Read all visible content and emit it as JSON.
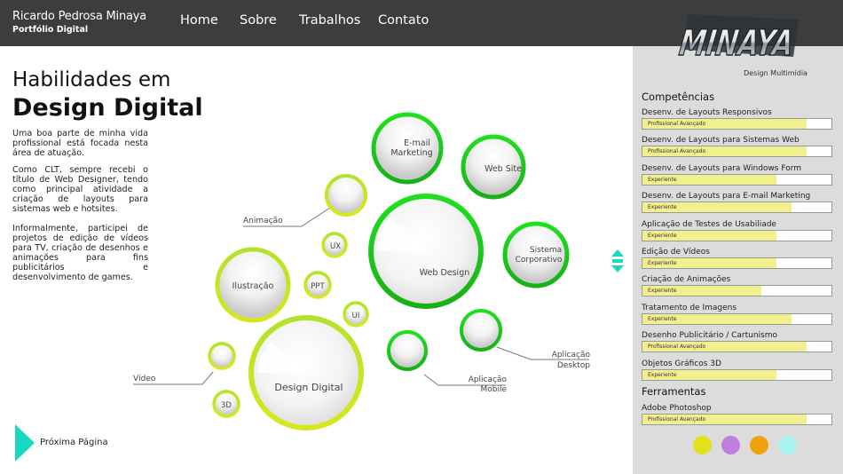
{
  "header": {
    "brand_name": "Ricardo Pedrosa Minaya",
    "brand_sub": "Portfólio Digital",
    "nav": [
      "Home",
      "Sobre",
      "Trabalhos",
      "Contato"
    ]
  },
  "logo": {
    "text": "MINAYA",
    "tagline": "Design Multimídia"
  },
  "intro": {
    "title_line1": "Habilidades em",
    "title_line2": "Design Digital",
    "paragraphs": [
      "Uma boa parte de minha vida profissional está focada nesta área de atuação.",
      "Como CLT, sempre recebi o título de Web Designer, tendo como principal atividade a criação de layouts para sistemas web e hotsites.",
      "Informalmente, participei de projetos de edição de vídeos para TV, criação de desenhos e animações para fins publicitários e desenvolvimento de games."
    ]
  },
  "bubbles": {
    "email": "E-mail\nMarketing",
    "website": "Web Site",
    "sistema": "Sistema\nCorporativo",
    "webdesign": "Web Design",
    "ilustracao": "Ilustração",
    "designdigital": "Design Digital",
    "ux": "UX",
    "ppt": "PPT",
    "ui": "UI",
    "threed": "3D",
    "animacao": "Animação",
    "video": "Vídeo",
    "app_mobile": "Aplicação\nMobile",
    "app_desktop": "Aplicação\nDesktop"
  },
  "competencias": {
    "title": "Competências",
    "items": [
      {
        "label": "Desenv. de Layouts Responsivos",
        "level": "Profissional Avançado",
        "pct": 0.87
      },
      {
        "label": "Desenv. de Layouts para Sistemas Web",
        "level": "Profissional Avançado",
        "pct": 0.87
      },
      {
        "label": "Desenv. de Layouts para Windows Form",
        "level": "Experiente",
        "pct": 0.71
      },
      {
        "label": "Desenv. de Layouts para E-mail Marketing",
        "level": "Experiente",
        "pct": 0.79
      },
      {
        "label": "Aplicação de Testes de Usabiliade",
        "level": "Experiente",
        "pct": 0.71
      },
      {
        "label": "Edição de Vídeos",
        "level": "Experiente",
        "pct": 0.71
      },
      {
        "label": "Criação de Animações",
        "level": "Experiente",
        "pct": 0.63
      },
      {
        "label": "Tratamento de Imagens",
        "level": "Experiente",
        "pct": 0.79
      },
      {
        "label": "Desenho Publicitário / Cartunismo",
        "level": "Profissional Avançado",
        "pct": 0.87
      },
      {
        "label": "Objetos Gráficos 3D",
        "level": "Experiente",
        "pct": 0.71
      }
    ]
  },
  "ferramentas": {
    "title": "Ferramentas",
    "items": [
      {
        "label": "Adobe Photoshop",
        "level": "Profissional Avançado",
        "pct": 0.87
      }
    ]
  },
  "theme_swatches": [
    "#e2e21a",
    "#c07ee0",
    "#eea20e",
    "#aaf3f0"
  ],
  "next_page": {
    "label": "Próxima Página"
  },
  "colors": {
    "accent": "#19d8c0",
    "header_bg": "#3d3d3d",
    "panel_bg": "#dcdcdc"
  }
}
